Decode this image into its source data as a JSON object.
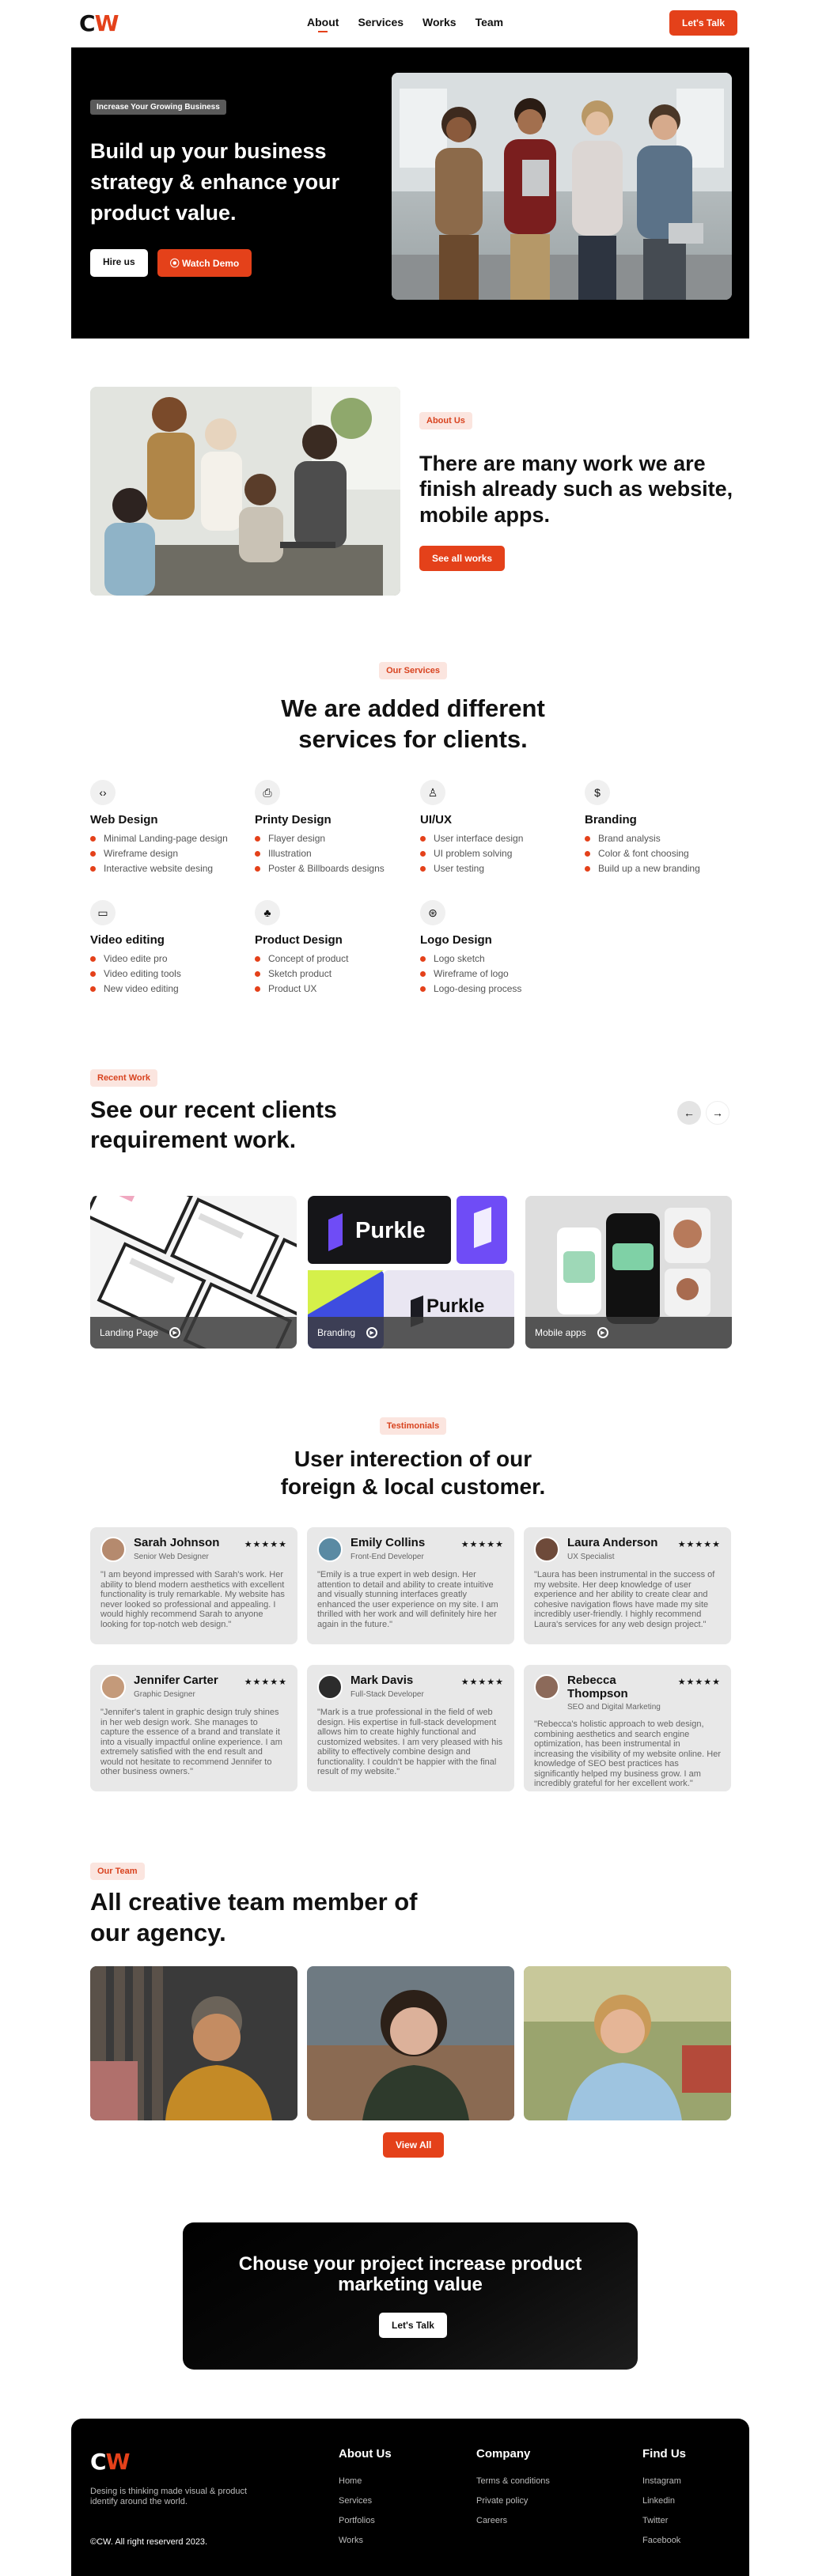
{
  "nav": {
    "logo_c": "C",
    "logo_w": "W",
    "links": [
      "About",
      "Services",
      "Works",
      "Team"
    ],
    "cta": "Let's Talk"
  },
  "hero": {
    "badge": "Increase Your Growing Business",
    "title": "Build up your business strategy & enhance your product value.",
    "hire": "Hire us",
    "watch": "⦿ Watch Demo"
  },
  "about": {
    "pill": "About Us",
    "title": "There are many work we are finish already such as website, mobile apps.",
    "button": "See all works"
  },
  "services": {
    "pill": "Our Services",
    "title_line1": "We are added different",
    "title_line2": "services for clients.",
    "items": [
      {
        "icon": "code-icon",
        "glyph": "‹›",
        "name": "Web Design",
        "bullets": [
          "Minimal Landing-page design",
          "Wireframe design",
          "Interactive website desing"
        ]
      },
      {
        "icon": "printer-icon",
        "glyph": "⎙",
        "name": "Printy Design",
        "bullets": [
          "Flayer design",
          "Illustration",
          "Poster & Billboards designs"
        ]
      },
      {
        "icon": "user-icon",
        "glyph": "♙",
        "name": "UI/UX",
        "bullets": [
          "User interface design",
          "UI problem solving",
          "User testing"
        ]
      },
      {
        "icon": "dollar-icon",
        "glyph": "$",
        "name": "Branding",
        "bullets": [
          "Brand analysis",
          "Color & font choosing",
          "Build up a new branding"
        ]
      },
      {
        "icon": "video-icon",
        "glyph": "▭",
        "name": "Video editing",
        "bullets": [
          "Video edite pro",
          "Video editing tools",
          "New video editing"
        ]
      },
      {
        "icon": "shapes-icon",
        "glyph": "♣",
        "name": "Product Design",
        "bullets": [
          "Concept of product",
          "Sketch product",
          "Product UX"
        ]
      },
      {
        "icon": "aperture-icon",
        "glyph": "⊛",
        "name": "Logo Design",
        "bullets": [
          "Logo sketch",
          "Wireframe of logo",
          "Logo-desing process"
        ]
      }
    ]
  },
  "work": {
    "pill": "Recent Work",
    "title": "See our recent clients requirement work.",
    "prev": "←",
    "next": "→",
    "cards": [
      {
        "label": "Landing Page"
      },
      {
        "label": "Branding",
        "brand_text": "Purkle"
      },
      {
        "label": "Mobile apps"
      }
    ]
  },
  "testimonials": {
    "pill": "Testimonials",
    "title_line1": "User interection of our",
    "title_line2": "foreign & local customer.",
    "stars": "★★★★★",
    "items": [
      {
        "name": "Sarah Johnson",
        "role": "Senior Web Designer",
        "quote": "\"I am beyond impressed with Sarah's work. Her ability to blend modern aesthetics with excellent functionality is truly remarkable. My website has never looked so professional and appealing. I would highly recommend Sarah to anyone looking for top-notch web design.\""
      },
      {
        "name": "Emily Collins",
        "role": "Front-End Developer",
        "quote": "\"Emily is a true expert in web design. Her attention to detail and ability to create intuitive and visually stunning interfaces greatly enhanced the user experience on my site. I am thrilled with her work and will definitely hire her again in the future.\""
      },
      {
        "name": "Laura Anderson",
        "role": "UX Specialist",
        "quote": "\"Laura has been instrumental in the success of my website. Her deep knowledge of user experience and her ability to create clear and cohesive navigation flows have made my site incredibly user-friendly. I highly recommend Laura's services for any web design project.\""
      },
      {
        "name": "Jennifer Carter",
        "role": "Graphic Designer",
        "quote": "\"Jennifer's talent in graphic design truly shines in her web design work. She manages to capture the essence of a brand and translate it into a visually impactful online experience. I am extremely satisfied with the end result and would not hesitate to recommend Jennifer to other business owners.\""
      },
      {
        "name": "Mark Davis",
        "role": "Full-Stack Developer",
        "quote": "\"Mark is a true professional in the field of web design. His expertise in full-stack development allows him to create highly functional and customized websites. I am very pleased with his ability to effectively combine design and functionality. I couldn't be happier with the final result of my website.\""
      },
      {
        "name": "Rebecca Thompson",
        "role": "SEO and Digital Marketing",
        "quote": "\"Rebecca's holistic approach to web design, combining aesthetics and search engine optimization, has been instrumental in increasing the visibility of my website online. Her knowledge of SEO best practices has significantly helped my business grow. I am incredibly grateful for her excellent work.\""
      }
    ]
  },
  "team": {
    "pill": "Our Team",
    "title": "All creative team member of our agency.",
    "button": "View All"
  },
  "cta": {
    "title_line1": "Chouse your project increase product",
    "title_line2": "marketing value",
    "button": "Let's Talk"
  },
  "footer": {
    "logo_c": "C",
    "logo_w": "W",
    "tagline": "Desing is thinking made visual & product identify around the world.",
    "copyright": "©CW. All right reserverd 2023.",
    "cols": [
      {
        "title": "About Us",
        "links": [
          "Home",
          "Services",
          "Portfolios",
          "Works"
        ]
      },
      {
        "title": "Company",
        "links": [
          "Terms & conditions",
          "Private policy",
          "Careers"
        ]
      },
      {
        "title": "Find Us",
        "links": [
          "Instagram",
          "Linkedin",
          "Twitter",
          "Facebook"
        ]
      }
    ]
  }
}
